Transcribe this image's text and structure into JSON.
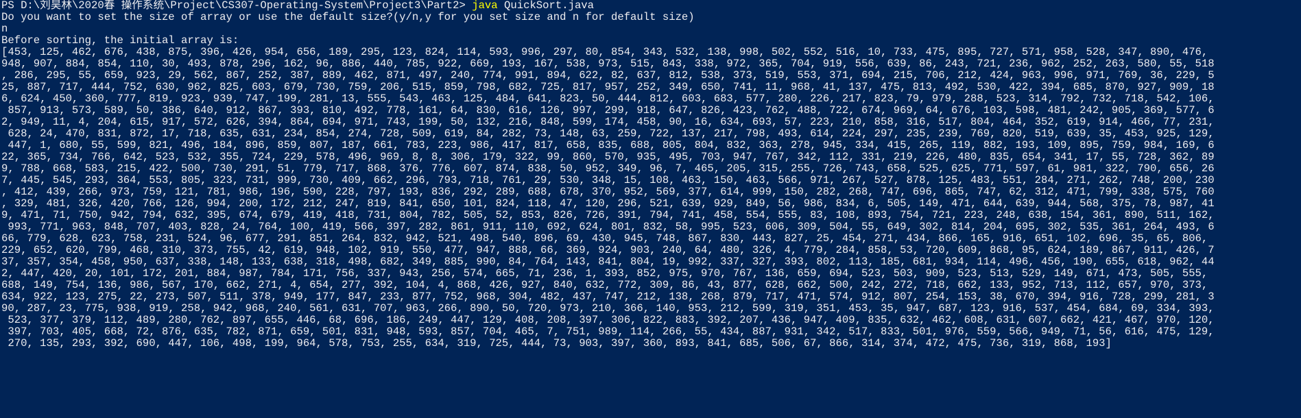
{
  "window": {
    "background": "#012456",
    "foreground": "#eeedf0",
    "command_color": "#ffff00"
  },
  "prompt": {
    "text": "PS D:\\刘昊林\\2020春 操作系统\\Project\\CS307-Operating-System\\Project3\\Part2> ",
    "command": "java",
    "argument": " QuickSort.java"
  },
  "output": {
    "question": "Do you want to set the size of array or use the default size?(y/n,y for you set size and n for default size)",
    "user_answer": "n",
    "before_label": "Before sorting, the initial array is:",
    "array_lines": [
      "[453, 125, 462, 676, 438, 875, 396, 426, 954, 656, 189, 295, 123, 824, 114, 593, 996, 297, 80, 854, 343, 532, 138, 998, 502, 552, 516, 10, 733, 475, 895, 727, 571, 958, 528, 347, 890, 476,",
      "948, 907, 884, 854, 110, 30, 493, 878, 296, 162, 96, 886, 440, 785, 922, 669, 193, 167, 538, 973, 515, 843, 338, 972, 365, 704, 919, 556, 639, 86, 243, 721, 236, 962, 252, 263, 580, 55, 518",
      ", 286, 295, 55, 659, 923, 29, 562, 867, 252, 387, 889, 462, 871, 497, 240, 774, 991, 894, 622, 82, 637, 812, 538, 373, 519, 553, 371, 694, 215, 706, 212, 424, 963, 996, 971, 769, 36, 229, 5",
      "25, 887, 717, 444, 752, 630, 962, 825, 603, 679, 730, 759, 206, 515, 859, 798, 682, 725, 817, 957, 252, 349, 650, 741, 11, 968, 41, 137, 475, 813, 492, 530, 422, 394, 685, 870, 927, 909, 18",
      "6, 624, 450, 360, 777, 819, 923, 939, 747, 199, 281, 13, 555, 543, 463, 125, 484, 641, 823, 50, 444, 812, 603, 683, 577, 280, 226, 217, 823, 79, 979, 288, 523, 314, 792, 732, 718, 542, 106,",
      " 857, 913, 573, 589, 50, 386, 640, 912, 867, 393, 810, 492, 778, 161, 64, 830, 616, 126, 997, 299, 918, 647, 826, 423, 762, 488, 722, 674, 969, 64, 676, 103, 598, 481, 242, 905, 369, 577, 6",
      "2, 949, 11, 4, 204, 615, 917, 572, 626, 394, 864, 694, 971, 743, 199, 50, 132, 216, 848, 599, 174, 458, 90, 16, 634, 693, 57, 223, 210, 858, 316, 517, 804, 464, 352, 619, 914, 466, 77, 231,",
      " 628, 24, 470, 831, 872, 17, 718, 635, 631, 234, 854, 274, 728, 509, 619, 84, 282, 73, 148, 63, 259, 722, 137, 217, 798, 493, 614, 224, 297, 235, 239, 769, 820, 519, 639, 35, 453, 925, 129,",
      " 447, 1, 680, 55, 599, 821, 496, 184, 896, 859, 807, 187, 661, 783, 223, 986, 417, 817, 658, 835, 688, 805, 804, 832, 363, 278, 945, 334, 415, 265, 119, 882, 193, 109, 895, 759, 984, 169, 6",
      "22, 365, 734, 766, 642, 523, 532, 355, 724, 229, 578, 496, 969, 8, 8, 306, 179, 322, 99, 860, 570, 935, 495, 703, 947, 767, 342, 112, 331, 219, 226, 480, 835, 654, 341, 17, 55, 728, 362, 89",
      "9, 788, 668, 583, 215, 422, 500, 730, 291, 51, 779, 717, 868, 376, 776, 607, 874, 838, 50, 952, 349, 96, 7, 465, 205, 315, 255, 726, 743, 658, 525, 625, 771, 597, 61, 981, 322, 790, 656, 26",
      "7, 445, 545, 293, 364, 553, 805, 323, 731, 999, 730, 409, 662, 296, 793, 718, 761, 29, 530, 348, 15, 108, 463, 150, 463, 566, 971, 267, 527, 878, 125, 483, 551, 284, 271, 262, 748, 200, 230",
      ", 412, 439, 266, 973, 759, 121, 781, 986, 196, 590, 228, 797, 193, 836, 292, 289, 688, 678, 370, 952, 569, 377, 614, 999, 150, 282, 268, 747, 696, 865, 747, 62, 312, 471, 799, 338, 575, 760",
      ", 329, 481, 326, 420, 766, 126, 994, 200, 172, 212, 247, 819, 841, 650, 101, 824, 118, 47, 120, 296, 521, 639, 929, 849, 56, 986, 834, 6, 505, 149, 471, 644, 639, 944, 568, 375, 78, 987, 41",
      "9, 471, 71, 750, 942, 794, 632, 395, 674, 679, 419, 418, 731, 804, 782, 505, 52, 853, 826, 726, 391, 794, 741, 458, 554, 555, 83, 108, 893, 754, 721, 223, 248, 638, 154, 361, 890, 511, 162,",
      " 993, 771, 963, 848, 707, 403, 828, 24, 764, 100, 419, 566, 397, 282, 861, 911, 110, 692, 624, 801, 832, 58, 995, 523, 606, 309, 504, 55, 649, 302, 814, 204, 695, 302, 535, 361, 264, 493, 6",
      "66, 779, 628, 623, 758, 231, 524, 96, 677, 291, 851, 264, 832, 942, 521, 498, 540, 896, 69, 430, 945, 748, 867, 830, 443, 827, 25, 454, 271, 434, 866, 165, 916, 651, 102, 696, 35, 65, 806,",
      "229, 652, 620, 799, 468, 310, 373, 755, 42, 619, 948, 102, 919, 550, 477, 947, 888, 66, 369, 924, 903, 240, 64, 480, 326, 4, 779, 284, 858, 53, 720, 609, 868, 95, 624, 189, 867, 911, 426, 7",
      "37, 357, 354, 458, 950, 637, 338, 148, 133, 638, 318, 498, 682, 349, 885, 990, 84, 764, 143, 841, 804, 19, 992, 337, 327, 393, 802, 113, 185, 681, 934, 114, 496, 456, 190, 655, 618, 962, 44",
      "2, 447, 420, 20, 101, 172, 201, 884, 987, 784, 171, 756, 337, 943, 256, 574, 665, 71, 236, 1, 393, 852, 975, 970, 767, 136, 659, 694, 523, 503, 909, 523, 513, 529, 149, 671, 473, 505, 555,",
      "688, 149, 754, 136, 986, 567, 170, 662, 271, 4, 654, 277, 392, 104, 4, 868, 426, 927, 840, 632, 772, 309, 86, 43, 877, 628, 662, 500, 242, 272, 718, 662, 133, 952, 713, 112, 657, 970, 373,",
      "634, 922, 123, 275, 22, 273, 507, 511, 378, 949, 177, 847, 233, 877, 752, 968, 304, 482, 437, 747, 212, 138, 268, 879, 717, 471, 574, 912, 807, 254, 153, 38, 670, 394, 916, 728, 299, 281, 3",
      "90, 287, 23, 775, 938, 919, 258, 942, 968, 240, 561, 631, 707, 963, 266, 890, 50, 720, 973, 210, 366, 140, 953, 212, 599, 319, 351, 453, 35, 947, 687, 123, 916, 537, 454, 684, 69, 334, 393,",
      " 523, 377, 379, 112, 489, 280, 762, 897, 655, 446, 68, 696, 186, 249, 447, 129, 408, 208, 397, 306, 822, 883, 392, 207, 436, 947, 409, 835, 632, 462, 608, 631, 607, 662, 421, 467, 970, 120,",
      " 397, 703, 405, 668, 72, 876, 635, 782, 871, 659, 501, 831, 948, 593, 857, 704, 465, 7, 751, 989, 114, 266, 55, 434, 887, 931, 342, 517, 833, 501, 976, 559, 566, 949, 71, 56, 616, 475, 129,",
      " 270, 135, 293, 392, 690, 447, 106, 498, 199, 964, 578, 753, 255, 634, 319, 725, 444, 73, 903, 397, 360, 893, 841, 685, 506, 67, 866, 314, 374, 472, 475, 736, 319, 868, 193]"
    ]
  }
}
